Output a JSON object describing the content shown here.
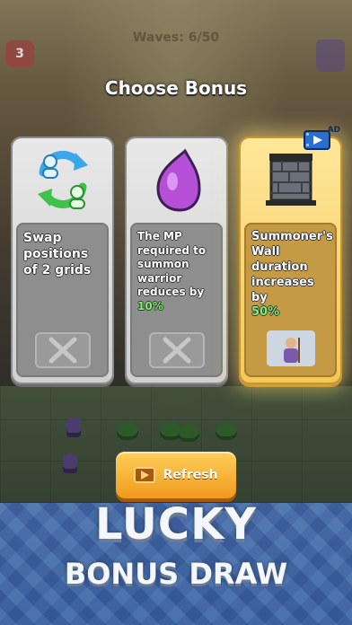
{
  "hud": {
    "waves": "Waves: 6/50",
    "hearts": "3"
  },
  "dialog": {
    "title": "Choose Bonus"
  },
  "cards": [
    {
      "desc": "Swap positions of 2 grids",
      "highlight": "",
      "locked": true,
      "ad": false,
      "icon": "swap-users-icon"
    },
    {
      "desc": "The MP required to summon warrior reduces by",
      "highlight": "10%",
      "locked": true,
      "ad": false,
      "icon": "purple-potion-icon"
    },
    {
      "desc": "Summoner's Wall duration increases by",
      "highlight": "50%",
      "locked": false,
      "ad": true,
      "icon": "stone-wall-icon"
    }
  ],
  "ad_badge": "AD",
  "refresh": {
    "label": "Refresh",
    "icon": "video-play-icon"
  },
  "promo": {
    "line1": "LUCKY",
    "line2": "BONUS DRAW"
  },
  "colors": {
    "gold": "#f2c85a",
    "highlight": "#7cf06a",
    "refresh": "#f09a1e"
  }
}
